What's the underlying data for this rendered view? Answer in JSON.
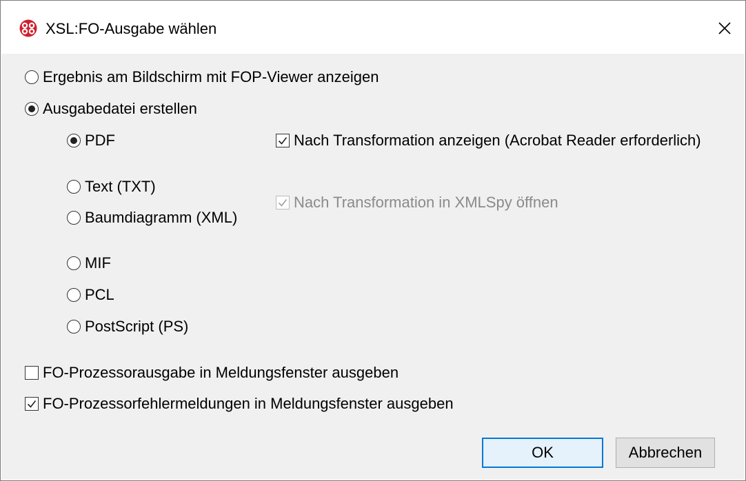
{
  "window": {
    "title": "XSL:FO-Ausgabe wählen",
    "icon": "altova-xmlspy-icon",
    "close_icon": "close-icon"
  },
  "output": {
    "viewer_option": {
      "label": "Ergebnis am Bildschirm mit FOP-Viewer anzeigen",
      "selected": false
    },
    "file_option": {
      "label": "Ausgabedatei erstellen",
      "selected": true
    }
  },
  "formats": [
    {
      "label": "PDF",
      "selected": true
    },
    {
      "label": "Text (TXT)",
      "selected": false
    },
    {
      "label": "Baumdiagramm (XML)",
      "selected": false
    },
    {
      "label": "MIF",
      "selected": false
    },
    {
      "label": "PCL",
      "selected": false
    },
    {
      "label": "PostScript (PS)",
      "selected": false
    }
  ],
  "after_transform": {
    "show_acrobat": {
      "label": "Nach Transformation anzeigen (Acrobat Reader erforderlich)",
      "checked": true,
      "enabled": true
    },
    "open_xmlspy": {
      "label": "Nach Transformation in XMLSpy öffnen",
      "checked": true,
      "enabled": false
    }
  },
  "messages": {
    "processor_output": {
      "label": "FO-Prozessorausgabe in Meldungsfenster ausgeben",
      "checked": false
    },
    "processor_errors": {
      "label": "FO-Prozessorfehlermeldungen in Meldungsfenster ausgeben",
      "checked": true
    }
  },
  "buttons": {
    "ok": "OK",
    "cancel": "Abbrechen"
  },
  "colors": {
    "accent": "#0078d7",
    "icon_red": "#d1202f",
    "dialog_bg": "#f0f0f0"
  }
}
